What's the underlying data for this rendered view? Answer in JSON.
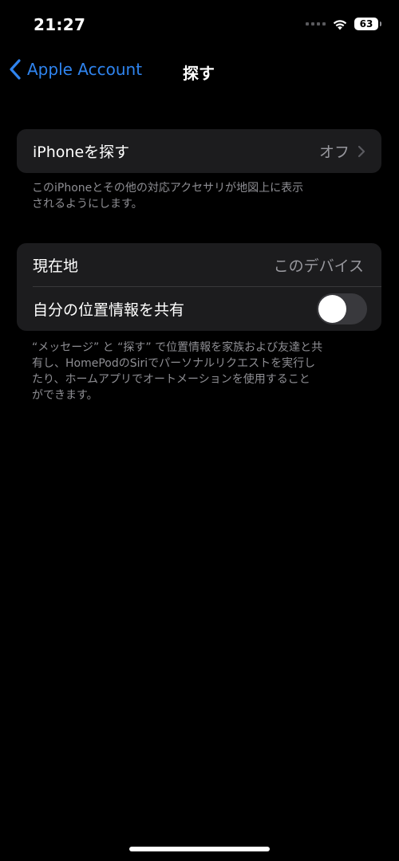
{
  "status_bar": {
    "time": "21:27",
    "battery": "63",
    "icons": [
      "cellular-dots-icon",
      "wifi-icon",
      "battery-icon"
    ]
  },
  "nav": {
    "back_label": "Apple Account",
    "back_icon": "chevron-left-icon",
    "title": "探す"
  },
  "find_iphone_section": {
    "row": {
      "label": "iPhoneを探す",
      "value": "オフ",
      "icon": "chevron-right-icon"
    },
    "footer_lines": [
      "このiPhoneとその他の対応アクセサリが地図上に表示",
      "されるようにします。"
    ]
  },
  "location_section": {
    "current_location": {
      "label": "現在地",
      "value": "このデバイス"
    },
    "share_location": {
      "label": "自分の位置情報を共有",
      "toggle_on": false
    },
    "footer_lines": [
      "“メッセージ” と “探す” で位置情報を家族および友達と共",
      "有し、HomePodのSiriでパーソナルリクエストを実行し",
      "たり、ホームアプリでオートメーションを使用すること",
      "ができます。"
    ]
  },
  "colors": {
    "background": "#000000",
    "group_background": "#1c1c1e",
    "accent": "#2f84ef",
    "secondary_text": "#98989e",
    "footer_text": "#8e8e93",
    "toggle_off": "#39393d"
  }
}
